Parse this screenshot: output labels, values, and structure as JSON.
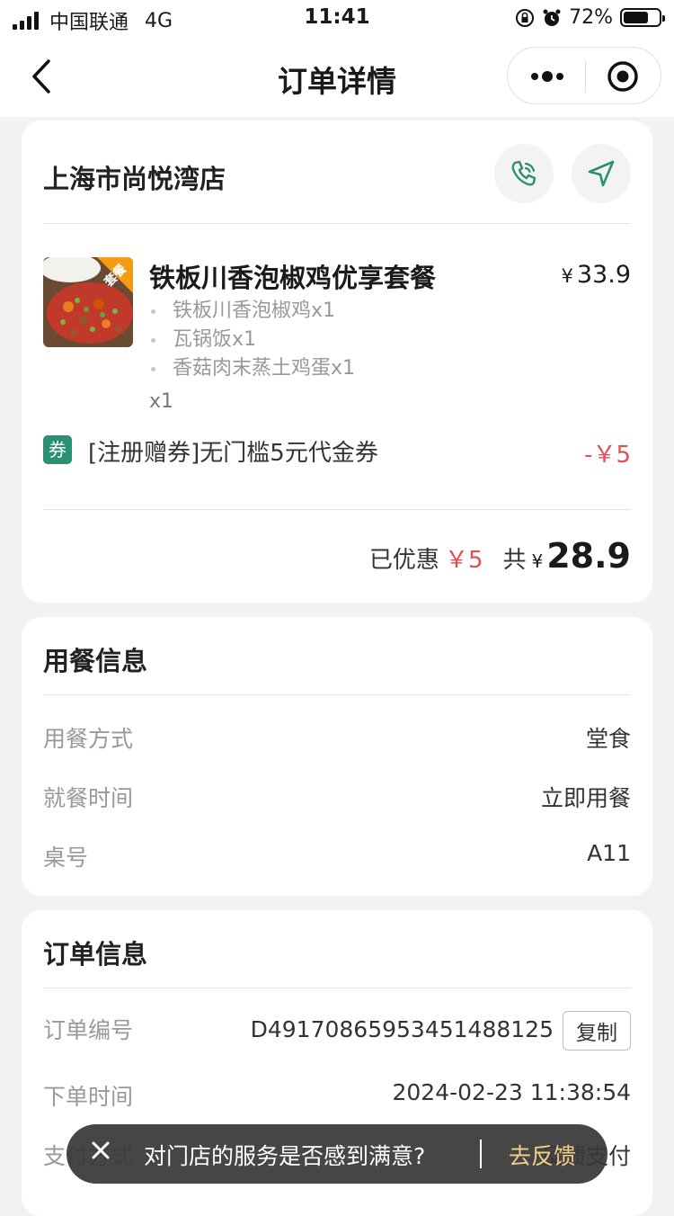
{
  "status_bar": {
    "carrier": "中国联通",
    "network": "4G",
    "time": "11:41",
    "battery": "72%",
    "battery_level": 0.72
  },
  "nav": {
    "title": "订单详情"
  },
  "store": {
    "name": "上海市尚悦湾店"
  },
  "dish": {
    "badge": "套餐",
    "title": "铁板川香泡椒鸡优享套餐",
    "currency": "¥",
    "price": "33.9",
    "items": [
      "铁板川香泡椒鸡x1",
      "瓦锅饭x1",
      "香菇肉末蒸土鸡蛋x1"
    ],
    "qty": "x1"
  },
  "coupon": {
    "tag": "券",
    "text": "[注册赠券]无门槛5元代金券",
    "amount": "-￥5"
  },
  "summary": {
    "discount_label": "已优惠",
    "discount_value": "￥5",
    "total_label": "共",
    "currency": "¥",
    "total": "28.9"
  },
  "dining": {
    "title": "用餐信息",
    "rows": [
      {
        "label": "用餐方式",
        "value": "堂食"
      },
      {
        "label": "就餐时间",
        "value": "立即用餐"
      },
      {
        "label": "桌号",
        "value": "A11"
      }
    ]
  },
  "order": {
    "title": "订单信息",
    "number_label": "订单编号",
    "number": "D4917086595345148812­5",
    "copy_label": "复制",
    "time_label": "下单时间",
    "time": "2024-02-23 11:38:54",
    "pay_label": "支付方式",
    "pay_value": "反馈支付"
  },
  "toast": {
    "message": "对门店的服务是否感到满意?",
    "action": "去反馈"
  },
  "colors": {
    "accent_green": "#2a8f73",
    "discount_red": "#e54d55",
    "toast_link": "#f4cf8a"
  }
}
